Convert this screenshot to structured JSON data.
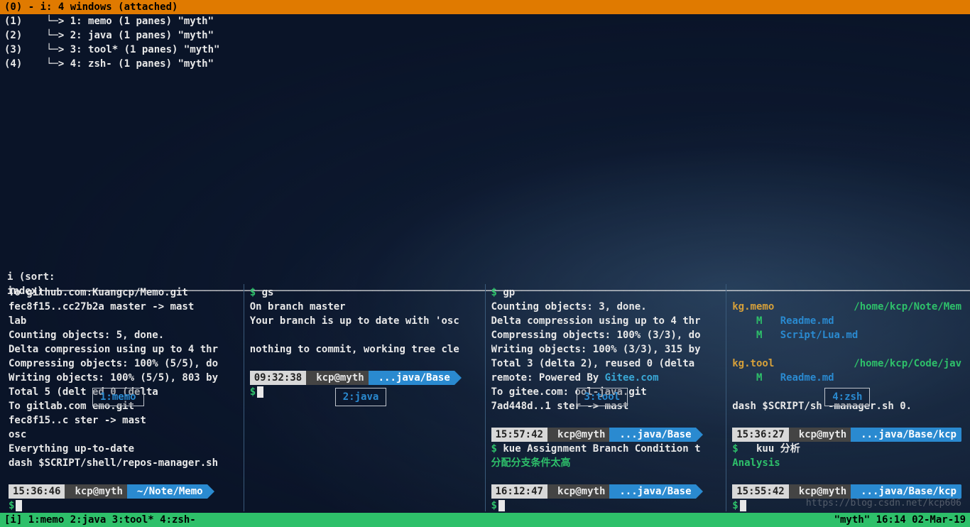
{
  "titlebar": "(0)   - i: 4 windows (attached)",
  "sessions": [
    {
      "idx": "(1)",
      "arrow": "└─> 1: memo (1 panes) \"myth\""
    },
    {
      "idx": "(2)",
      "arrow": "└─> 2: java (1 panes) \"myth\""
    },
    {
      "idx": "(3)",
      "arrow": "└─> 3: tool* (1 panes) \"myth\""
    },
    {
      "idx": "(4)",
      "arrow": "└─> 4: zsh- (1 panes) \"myth\""
    }
  ],
  "sort_line": "i (sort: index)───────────────────────────────────────────────────────────────────────────────────────────────────────────────────────────────────────────────────────────────",
  "pane1": {
    "lines": [
      "To github.com:Kuangcp/Memo.git",
      "   fec8f15..cc27b2a  master -> mast",
      "lab",
      "Counting objects: 5, done.",
      "Delta compression using up to 4 thr",
      "Compressing objects: 100% (5/5), do",
      "Writing objects: 100% (5/5), 803 by",
      "Total 5 (delt           ed 0 (delta",
      "To gitlab.com           emo.git",
      "   fec8f15..c           ster -> mast",
      "osc",
      "Everything up-to-date",
      "dash $SCRIPT/shell/repos-manager.sh"
    ],
    "prompt": {
      "time": "15:36:46",
      "host": "kcp@myth",
      "path": "~/Note/Memo"
    },
    "dollar": "$",
    "label": "1:memo"
  },
  "pane2": {
    "cmd": "$ gs",
    "lines": [
      "On branch master",
      "Your branch is up to date with 'osc",
      "",
      "nothing to commit, working tree cle"
    ],
    "prompt": {
      "time": "09:32:38",
      "host": "kcp@myth",
      "path": "...java/Base"
    },
    "dollar": "$",
    "label": "2:java"
  },
  "pane3": {
    "cmd": "$ gp",
    "lines": [
      "Counting objects: 3, done.",
      "Delta compression using up to 4 thr",
      "Compressing objects: 100% (3/3), do",
      "Writing objects: 100% (3/3), 315 by",
      "Total 3 (delta 2), reused 0 (delta"
    ],
    "remote": "remote: Powered By ",
    "gitee": "Gitee.com",
    "l7": "To gitee.com:          ool-java.git",
    "l8": "   7ad448d..1          ster -> mast",
    "prompt1": {
      "time": "15:57:42",
      "host": "kcp@myth",
      "path": "...java/Base"
    },
    "cmd2": "$ kue Assignment Branch Condition t",
    "cn": "分配分支条件太高",
    "prompt2": {
      "time": "16:12:47",
      "host": "kcp@myth",
      "path": "...java/Base"
    },
    "dollar": "$",
    "label": "3:tool"
  },
  "pane4": {
    "repo1": "kg.memo",
    "path1": "/home/kcp/Note/Mem",
    "m": "M",
    "f1": "Readme.md",
    "f2": "Script/Lua.md",
    "repo2": "kg.tool",
    "path2": "/home/kcp/Code/jav",
    "f3": "Readme.md",
    "dash": "dash $SCRIPT/sh          -manager.sh  0.",
    "prompt1": {
      "time": "15:36:27",
      "host": "kcp@myth",
      "path": "...java/Base/kcp"
    },
    "cmd2": "$   kuu 分析",
    "analysis": "Analysis",
    "prompt2": {
      "time": "15:55:42",
      "host": "kcp@myth",
      "path": "...java/Base/kcp"
    },
    "dollar": "$",
    "label": "4:zsh"
  },
  "statusbar": {
    "left": "[i] 1:memo  2:java  3:tool* 4:zsh-",
    "right": "\"myth\" 16:14 02-Mar-19"
  },
  "watermark": "https://blog.csdn.net/kcp606"
}
